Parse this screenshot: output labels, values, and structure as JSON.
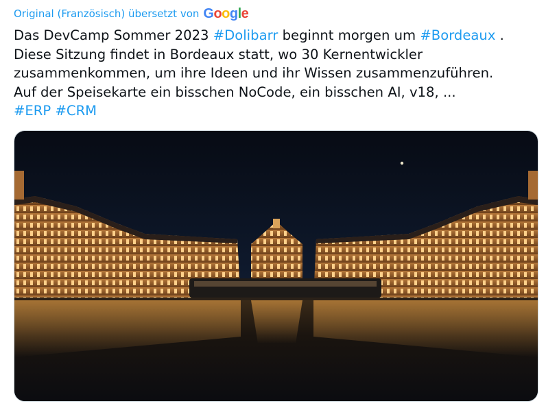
{
  "translation": {
    "prefix": "Original (Französisch) übersetzt von",
    "logo": "Google"
  },
  "tweet": {
    "line1": {
      "t1": "Das DevCamp Sommer 2023 ",
      "h1": "#Dolibarr",
      "t2": " beginnt morgen um ",
      "h2": "#Bordeaux",
      "t3": " ."
    },
    "line2": "Diese Sitzung findet in Bordeaux statt, wo 30 Kernentwickler",
    "line3": "zusammenkommen, um ihre Ideen und ihr Wissen zusammenzuführen.",
    "line4": "Auf der Speisekarte ein bisschen NoCode, ein bisschen AI, v18, ...",
    "line5": {
      "h1": "#ERP",
      "h2": "#CRM"
    }
  },
  "colors": {
    "link": "#1d9bf0",
    "text": "#0f1419",
    "sky": "#0b1220",
    "glow": "#e09a3c"
  },
  "media": {
    "icon": "photo-place-de-la-bourse-night"
  }
}
